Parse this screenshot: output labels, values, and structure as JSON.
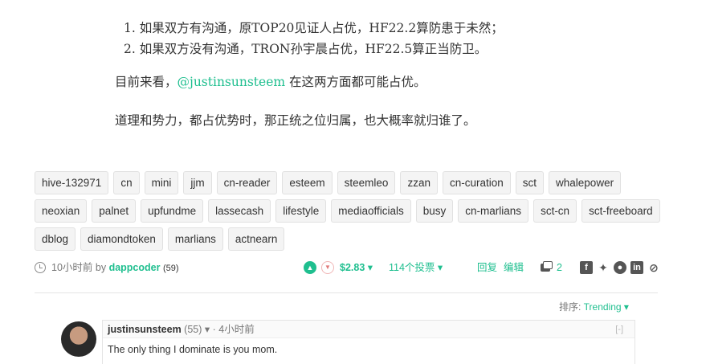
{
  "post": {
    "list_items": [
      "1. 如果双方有沟通，原TOP20见证人占优，HF22.2算防患于未然；",
      "2. 如果双方没有沟通，TRON孙宇晨占优，HF22.5算正当防卫。"
    ],
    "para1_prefix": "目前来看，",
    "para1_mention": "@justinsunsteem",
    "para1_suffix": " 在这两方面都可能占优。",
    "para2": "道理和势力，都占优势时，那正统之位归属，也大概率就归谁了。"
  },
  "tags": {
    "row1": [
      "hive-132971",
      "cn",
      "mini",
      "jjm",
      "cn-reader",
      "esteem",
      "steemleo",
      "zzan",
      "cn-curation",
      "sct",
      "whalepower"
    ],
    "row2": [
      "neoxian",
      "palnet",
      "upfundme",
      "lassecash",
      "lifestyle",
      "mediaofficials",
      "busy",
      "cn-marlians",
      "sct-cn",
      "sct-freeboard"
    ],
    "row3": [
      "dblog",
      "diamondtoken",
      "marlians",
      "actnearn"
    ]
  },
  "meta": {
    "time": "10小时前 by ",
    "author": "dappcoder",
    "reputation": "(59)",
    "payout": "$2.83 ▾",
    "votes": "114个投票 ▾",
    "reply": "回复",
    "edit": "编辑",
    "comments_count": "2",
    "icons": [
      "clock-icon",
      "upvote-icon",
      "downvote-icon",
      "comments-icon",
      "facebook-icon",
      "twitter-icon",
      "reddit-icon",
      "linkedin-icon",
      "link-icon"
    ]
  },
  "sort": {
    "label": "排序: ",
    "value": "Trending ▾"
  },
  "comment": {
    "author": "justinsunsteem",
    "reputation": "(55) ▾",
    "time": " · 4小时前",
    "collapse": "[-]",
    "body": "The only thing I dominate is you mom."
  },
  "colors": {
    "accent": "#1fbf8f",
    "text": "#333333",
    "muted": "#777777"
  }
}
